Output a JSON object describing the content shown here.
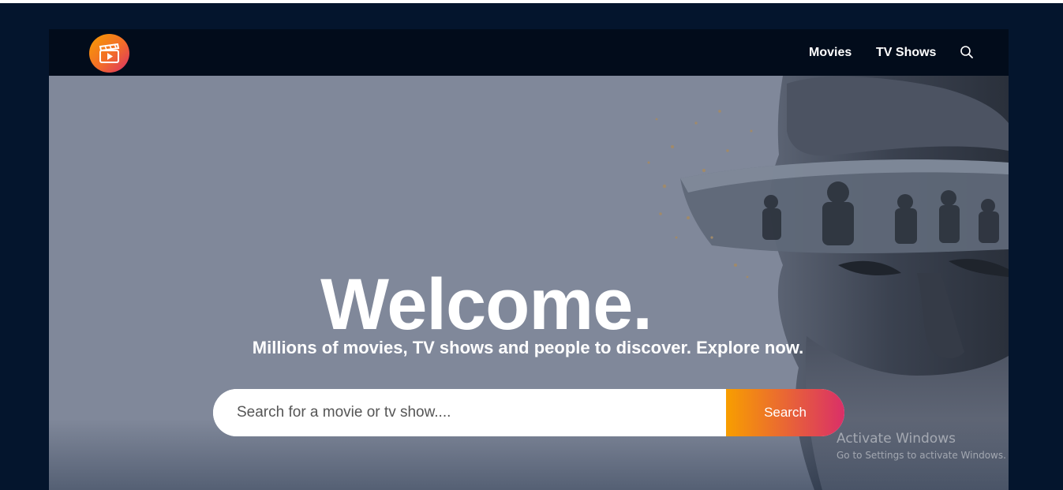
{
  "header": {
    "nav": [
      {
        "label": "Movies"
      },
      {
        "label": "TV Shows"
      }
    ],
    "search_icon": "search-icon",
    "logo_icon": "clapperboard-play-icon"
  },
  "hero": {
    "title": "Welcome.",
    "subtitle": "Millions of movies, TV shows and people to discover. Explore now.",
    "search": {
      "placeholder": "Search for a movie or tv show....",
      "value": "",
      "button_label": "Search"
    }
  },
  "os_watermark": {
    "title": "Activate Windows",
    "subtitle": "Go to Settings to activate Windows."
  },
  "colors": {
    "page_bg": "#04152d",
    "header_bg": "#020c1b",
    "hero_bg": "#80889a",
    "gradient_start": "#f89e00",
    "gradient_end": "#da2f68"
  }
}
